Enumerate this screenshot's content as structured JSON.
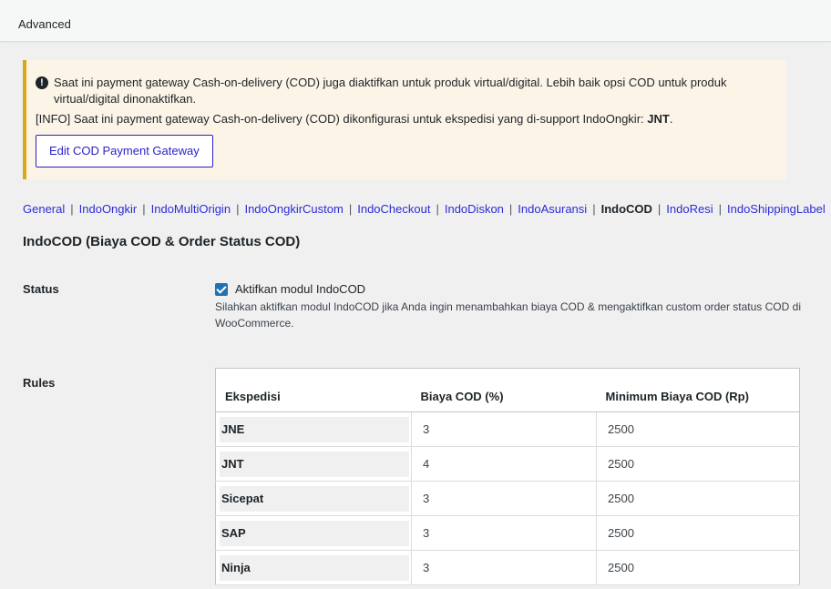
{
  "topbar": {
    "tab_label": "Advanced"
  },
  "notice": {
    "line1": "Saat ini payment gateway Cash-on-delivery (COD) juga diaktifkan untuk produk virtual/digital. Lebih baik opsi COD untuk produk virtual/digital dinonaktifkan.",
    "line2_prefix": "[INFO] Saat ini payment gateway Cash-on-delivery (COD) dikonfigurasi untuk ekspedisi yang di-support IndoOngkir: ",
    "line2_bold": "JNT",
    "line2_suffix": ".",
    "button_label": "Edit COD Payment Gateway"
  },
  "subnav": {
    "items": [
      "General",
      "IndoOngkir",
      "IndoMultiOrigin",
      "IndoOngkirCustom",
      "IndoCheckout",
      "IndoDiskon",
      "IndoAsuransi",
      "IndoCOD",
      "IndoResi",
      "IndoShippingLabel"
    ],
    "separator": "|"
  },
  "page_title": "IndoCOD (Biaya COD & Order Status COD)",
  "status": {
    "label": "Status",
    "checkbox_label": "Aktifkan modul IndoCOD",
    "checked": true,
    "description": "Silahkan aktifkan modul IndoCOD jika Anda ingin menambahkan biaya COD & mengaktifkan custom order status COD di WooCommerce."
  },
  "rules": {
    "label": "Rules",
    "headers": [
      "Ekspedisi",
      "Biaya COD (%)",
      "Minimum Biaya COD (Rp)"
    ],
    "rows": [
      [
        "JNE",
        "3",
        "2500"
      ],
      [
        "JNT",
        "4",
        "2500"
      ],
      [
        "Sicepat",
        "3",
        "2500"
      ],
      [
        "SAP",
        "3",
        "2500"
      ],
      [
        "Ninja",
        "3",
        "2500"
      ]
    ]
  }
}
